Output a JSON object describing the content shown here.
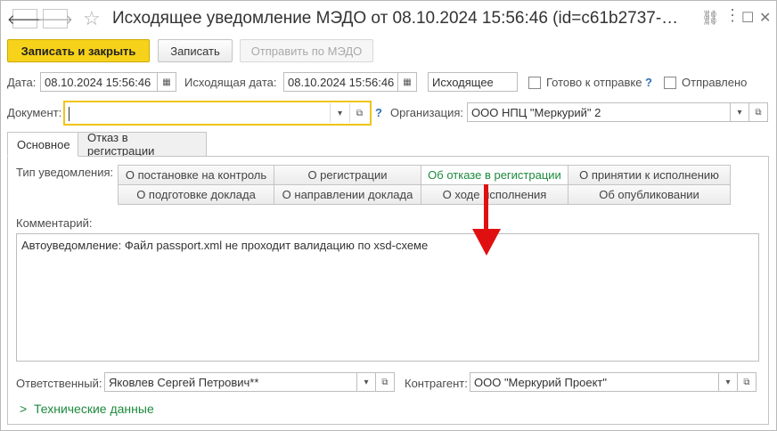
{
  "title": "Исходящее уведомление МЭДО от 08.10.2024 15:56:46 (id=c61b2737-…",
  "icons": {
    "back": "arrow-left-icon",
    "forward": "arrow-right-icon",
    "favorite": "star-icon",
    "link": "link-icon",
    "more": "more-icon",
    "maximize": "maximize-icon",
    "close": "close-icon"
  },
  "toolbar": {
    "save_close": "Записать и закрыть",
    "save": "Записать",
    "send": "Отправить по МЭДО"
  },
  "header": {
    "date_label": "Дата:",
    "date_value": "08.10.2024 15:56:46",
    "out_date_label": "Исходящая дата:",
    "out_date_value": "08.10.2024 15:56:46",
    "direction_value": "Исходящее",
    "ready_label": "Готово к отправке",
    "ready_help": "?",
    "sent_label": "Отправлено"
  },
  "document": {
    "label": "Документ:",
    "value": "",
    "help": "?",
    "org_label": "Организация:",
    "org_value": "ООО НПЦ \"Меркурий\" 2"
  },
  "tabs": [
    {
      "label": "Основное",
      "active": true
    },
    {
      "label": "Отказ в регистрации",
      "active": false
    }
  ],
  "notification": {
    "label": "Тип уведомления:",
    "options_row1": [
      "О постановке на контроль",
      "О регистрации",
      "Об отказе в регистрации",
      "О принятии к исполнению"
    ],
    "options_row2": [
      "О подготовке доклада",
      "О направлении доклада",
      "О ходе исполнения",
      "Об опубликовании"
    ],
    "selected": "Об отказе в регистрации",
    "accent_color": "#1d8a3e"
  },
  "comment": {
    "label": "Комментарий:",
    "value": "Автоуведомление: Файл passport.xml не проходит валидацию по xsd-схеме"
  },
  "footer": {
    "responsible_label": "Ответственный:",
    "responsible_value": "Яковлев Сергей Петрович**",
    "counterparty_label": "Контрагент:",
    "counterparty_value": "ООО \"Меркурий Проект\"",
    "tech_link": "Технические данные"
  },
  "annotation": {
    "color": "#e01010",
    "shape": "arrow-down"
  }
}
